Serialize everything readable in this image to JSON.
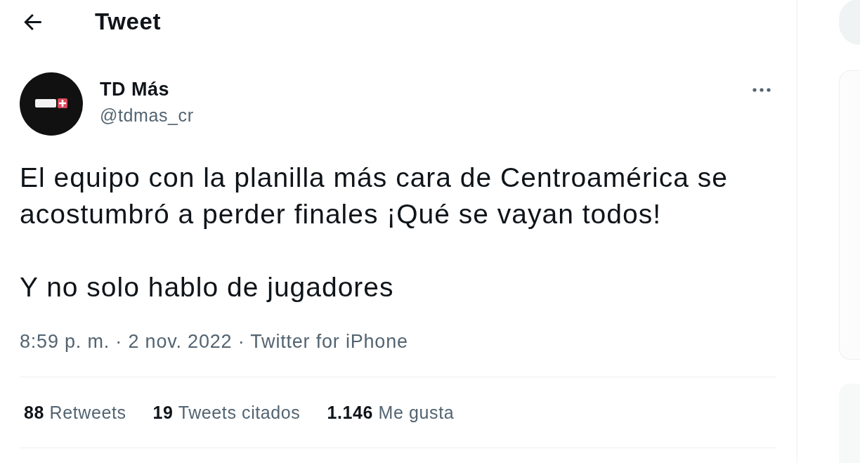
{
  "header": {
    "title": "Tweet"
  },
  "tweet": {
    "author": {
      "name": "TD Más",
      "handle": "@tdmas_cr"
    },
    "paragraphs": [
      "El equipo con la planilla más cara de Centroamérica se acostumbró a perder finales ¡Qué se vayan todos!",
      "Y no solo hablo de jugadores"
    ],
    "meta": "8:59 p. m. · 2 nov. 2022 · Twitter for iPhone",
    "stats": [
      {
        "count": "88",
        "label": "Retweets"
      },
      {
        "count": "19",
        "label": "Tweets citados"
      },
      {
        "count": "1.146",
        "label": "Me gusta"
      }
    ]
  }
}
